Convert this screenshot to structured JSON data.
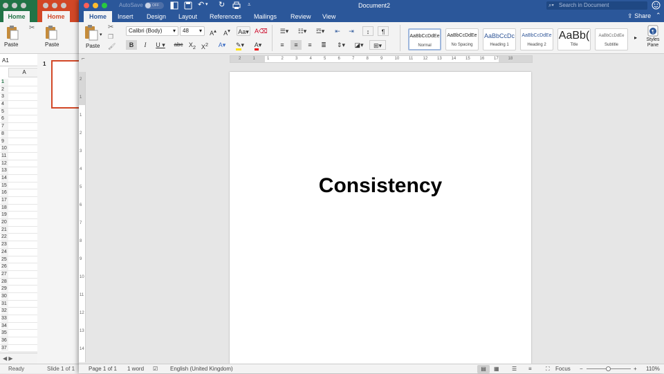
{
  "excel": {
    "tab_home": "Home",
    "paste_label": "Paste",
    "name_box": "A1",
    "column_header": "A",
    "row_numbers": [
      "1",
      "2",
      "3",
      "4",
      "5",
      "6",
      "7",
      "8",
      "9",
      "10",
      "11",
      "12",
      "13",
      "14",
      "15",
      "16",
      "17",
      "18",
      "19",
      "20",
      "21",
      "22",
      "23",
      "24",
      "25",
      "26",
      "27",
      "28",
      "29",
      "30",
      "31",
      "32",
      "33",
      "34",
      "35",
      "36",
      "37"
    ],
    "status": "Ready",
    "accent": "#217346"
  },
  "powerpoint": {
    "tab_home": "Home",
    "paste_label": "Paste",
    "slide_number": "1",
    "status": "Slide 1 of 1",
    "accent": "#d24726"
  },
  "word": {
    "accent": "#2b579a",
    "autosave_label": "AutoSave",
    "autosave_state": "OFF",
    "doc_title": "Document2",
    "search_placeholder": "Search in Document",
    "share_label": "Share",
    "tabs": [
      "Home",
      "Insert",
      "Design",
      "Layout",
      "References",
      "Mailings",
      "Review",
      "View"
    ],
    "paste_label": "Paste",
    "font_name": "Calibri (Body)",
    "font_size": "48",
    "styles": [
      {
        "preview": "AaBbCcDdEe",
        "name": "Normal"
      },
      {
        "preview": "AaBbCcDdEe",
        "name": "No Spacing"
      },
      {
        "preview": "AaBbCcDc",
        "name": "Heading 1"
      },
      {
        "preview": "AaBbCcDdEe",
        "name": "Heading 2"
      },
      {
        "preview": "AaBb(",
        "name": "Title"
      },
      {
        "preview": "AaBbCcDdEe",
        "name": "Subtitle"
      }
    ],
    "styles_pane_label": "Styles\nPane",
    "ruler_numbers": [
      "2",
      "1",
      "1",
      "2",
      "3",
      "4",
      "5",
      "6",
      "7",
      "8",
      "9",
      "10",
      "11",
      "12",
      "13",
      "14",
      "15",
      "16",
      "17",
      "18"
    ],
    "vruler_numbers": [
      "2",
      "1",
      "1",
      "2",
      "3",
      "4",
      "5",
      "6",
      "7",
      "8",
      "9",
      "10",
      "11",
      "12",
      "13",
      "14",
      "15"
    ],
    "document_text": "Consistency",
    "status": {
      "page": "Page 1 of 1",
      "words": "1 word",
      "language": "English (United Kingdom)",
      "focus": "Focus",
      "zoom": "110%"
    }
  }
}
